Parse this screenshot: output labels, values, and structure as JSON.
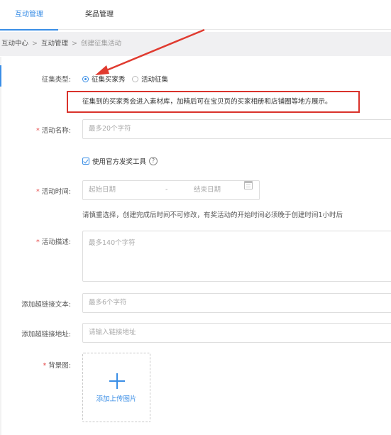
{
  "tabs": [
    {
      "label": "互动管理",
      "active": true
    },
    {
      "label": "奖品管理",
      "active": false
    }
  ],
  "breadcrumb": [
    "互动中心",
    "互动管理",
    "创建征集活动"
  ],
  "form": {
    "type_label": "征集类型:",
    "type_options": [
      "征集买家秀",
      "活动征集"
    ],
    "type_selected": "征集买家秀",
    "notice": "征集到的买家秀会进入素材库，加精后可在宝贝页的买家相册和店铺圈等地方展示。",
    "name_label": "活动名称:",
    "name_placeholder": "最多20个字符",
    "official_tool_label": "使用官方发奖工具",
    "official_tool_checked": true,
    "time_label": "活动时间:",
    "start_placeholder": "起始日期",
    "date_separator": "-",
    "end_placeholder": "结束日期",
    "time_hint": "请慎重选择，创建完成后时间不可修改，有奖活动的开始时间必须晚于创建时间1小时后",
    "desc_label": "活动描述:",
    "desc_placeholder": "最多140个字符",
    "link_text_label": "添加超链接文本:",
    "link_text_placeholder": "最多6个字符",
    "link_url_label": "添加超链接地址:",
    "link_url_placeholder": "请输入链接地址",
    "bg_label": "背景图:",
    "upload_label": "添加上传图片",
    "required_mark": "*",
    "help_symbol": "?"
  },
  "colors": {
    "accent": "#3a8ee6",
    "notice_border": "#d9322b",
    "annotation_arrow": "#e03a2f"
  }
}
